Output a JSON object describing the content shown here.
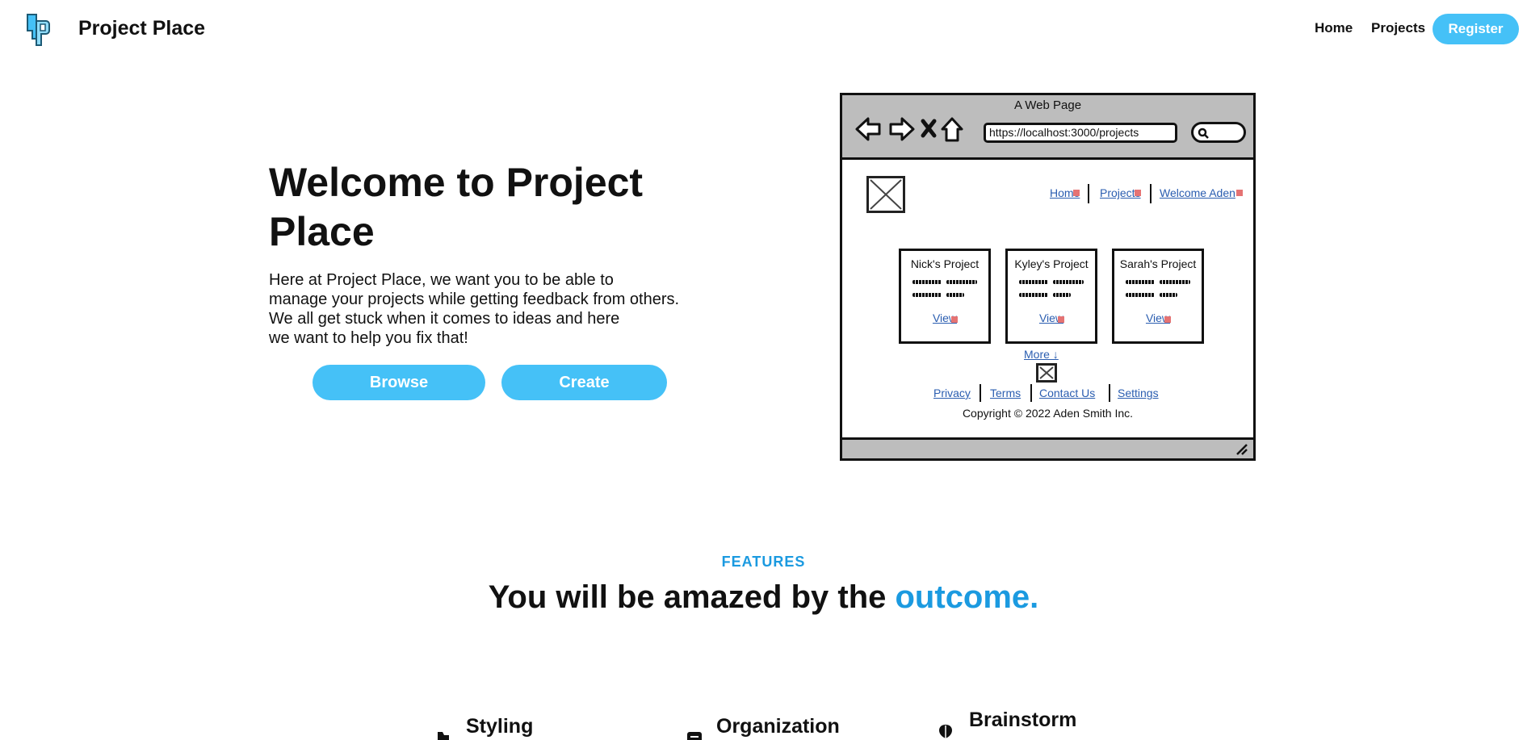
{
  "header": {
    "brand": "Project Place",
    "nav": {
      "home": "Home",
      "projects": "Projects",
      "register": "Register"
    }
  },
  "hero": {
    "title": "Welcome to Project Place",
    "description_lines": [
      "Here at Project Place, we want you to be able to",
      "manage your projects while getting feedback from others.",
      "We all get stuck when it comes to ideas and here",
      "we want to help you fix that!"
    ],
    "browse_label": "Browse",
    "create_label": "Create"
  },
  "wireframe": {
    "window_title": "A Web Page",
    "url": "https://localhost:3000/projects",
    "nav": [
      "Home",
      "Projects",
      "Welcome Aden"
    ],
    "cards": [
      {
        "title": "Nick's Project",
        "link": "View"
      },
      {
        "title": "Kyley's Project",
        "link": "View"
      },
      {
        "title": "Sarah's Project",
        "link": "View"
      }
    ],
    "more": "More ↓",
    "footer_links": [
      "Privacy",
      "Terms",
      "Contact Us",
      "Settings"
    ],
    "copyright": "Copyright © 2022 Aden Smith Inc."
  },
  "features": {
    "label": "FEATURES",
    "title_main": "You will be amazed by the ",
    "title_accent": "outcome.",
    "items": [
      {
        "title": "Styling",
        "icon": "palette-icon"
      },
      {
        "title": "Organization",
        "icon": "clipboard-icon"
      },
      {
        "title": "Brainstorm",
        "icon": "brain-icon"
      }
    ]
  },
  "colors": {
    "accent": "#45c1f7",
    "accent_text": "#1b9ae0",
    "wire_link": "#2a5db0"
  }
}
